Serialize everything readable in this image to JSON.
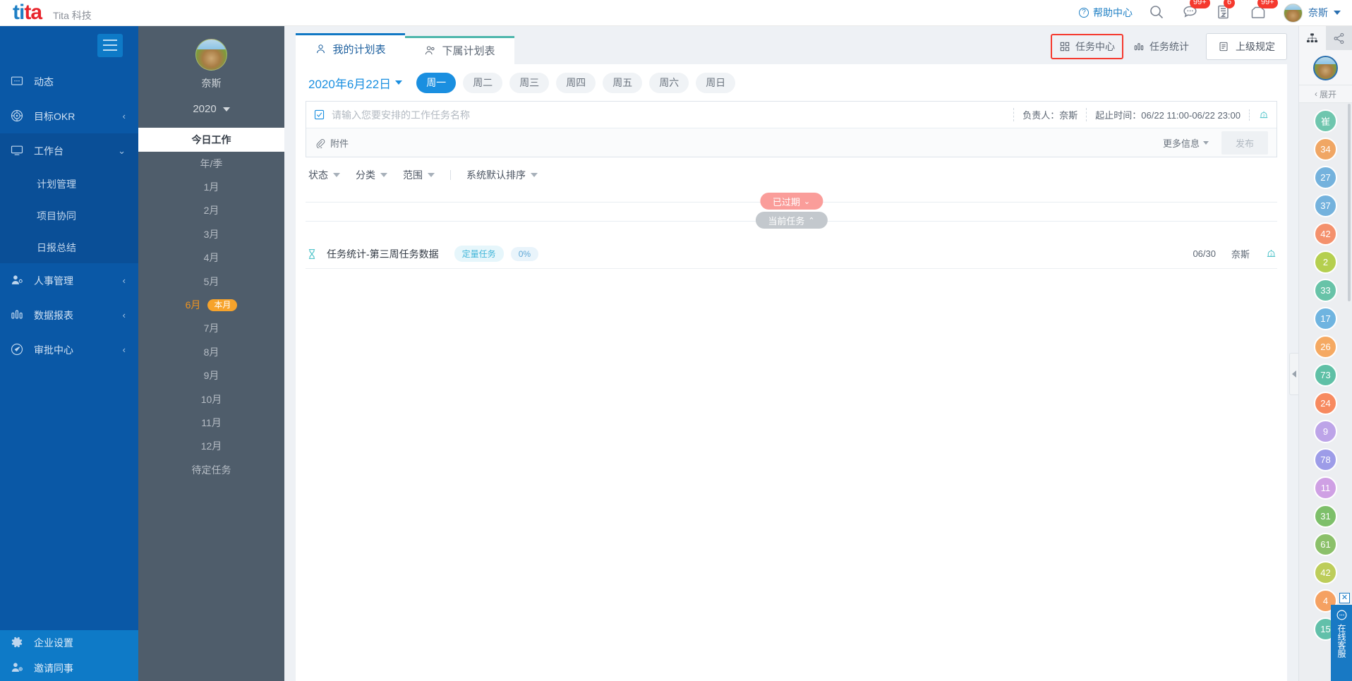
{
  "header": {
    "logo_text": "tita",
    "brand_sub": "Tita 科技",
    "help_center": "帮助中心",
    "icons": {
      "search": "search-icon",
      "message": "message-icon",
      "archive": "archive-icon",
      "mail": "mail-icon"
    },
    "badges": {
      "message": "99+",
      "archive": "6",
      "mail": "99+"
    },
    "user_name": "奈斯"
  },
  "sidebar": {
    "items": [
      {
        "label": "动态",
        "icon": "feed-icon",
        "chevron": "",
        "expanded": false
      },
      {
        "label": "目标OKR",
        "icon": "target-icon",
        "chevron": "‹",
        "expanded": false
      },
      {
        "label": "工作台",
        "icon": "desktop-icon",
        "chevron": "⌄",
        "expanded": true
      },
      {
        "label": "人事管理",
        "icon": "people-icon",
        "chevron": "‹",
        "expanded": false
      },
      {
        "label": "数据报表",
        "icon": "chart-icon",
        "chevron": "‹",
        "expanded": false
      },
      {
        "label": "审批中心",
        "icon": "approval-icon",
        "chevron": "‹",
        "expanded": false
      }
    ],
    "sub_items": [
      "计划管理",
      "项目协同",
      "日报总结"
    ],
    "bottom_items": [
      {
        "label": "企业设置",
        "icon": "gear-icon"
      },
      {
        "label": "邀请同事",
        "icon": "add-user-icon"
      }
    ]
  },
  "midbar": {
    "user_name": "奈斯",
    "year": "2020",
    "rows": [
      {
        "label": "今日工作",
        "state": "active"
      },
      {
        "label": "年/季",
        "state": "normal"
      },
      {
        "label": "1月",
        "state": "normal"
      },
      {
        "label": "2月",
        "state": "normal"
      },
      {
        "label": "3月",
        "state": "normal"
      },
      {
        "label": "4月",
        "state": "normal"
      },
      {
        "label": "5月",
        "state": "normal"
      },
      {
        "label": "6月",
        "state": "current",
        "pill": "本月"
      },
      {
        "label": "7月",
        "state": "normal"
      },
      {
        "label": "8月",
        "state": "normal"
      },
      {
        "label": "9月",
        "state": "normal"
      },
      {
        "label": "10月",
        "state": "normal"
      },
      {
        "label": "11月",
        "state": "normal"
      },
      {
        "label": "12月",
        "state": "normal"
      },
      {
        "label": "待定任务",
        "state": "normal"
      }
    ]
  },
  "main": {
    "tabs": [
      {
        "label": "我的计划表",
        "icon": "user-icon",
        "active": true
      },
      {
        "label": "下属计划表",
        "icon": "users-icon",
        "active": false
      }
    ],
    "actions": {
      "task_center": "任务中心",
      "task_stats": "任务统计",
      "superior_rules": "上级规定"
    },
    "date_selector": "2020年6月22日",
    "weekdays": [
      {
        "label": "周一",
        "selected": true
      },
      {
        "label": "周二",
        "selected": false
      },
      {
        "label": "周三",
        "selected": false
      },
      {
        "label": "周四",
        "selected": false
      },
      {
        "label": "周五",
        "selected": false
      },
      {
        "label": "周六",
        "selected": false
      },
      {
        "label": "周日",
        "selected": false
      }
    ],
    "input": {
      "placeholder": "请输入您要安排的工作任务名称",
      "value": "",
      "owner_label": "负责人：",
      "owner_value": "奈斯",
      "time_label": "起止时间：",
      "time_value": "06/22 11:00-06/22 23:00",
      "attach_label": "附件",
      "more_info_label": "更多信息",
      "publish_label": "发布"
    },
    "filters": [
      {
        "label": "状态"
      },
      {
        "label": "分类"
      },
      {
        "label": "范围"
      }
    ],
    "sort_label": "系统默认排序",
    "dividers": [
      {
        "label": "已过期",
        "arrow": "⌄",
        "kind": "expired"
      },
      {
        "label": "当前任务",
        "arrow": "⌃",
        "kind": "current"
      }
    ],
    "tasks": [
      {
        "title": "任务统计-第三周任务数据",
        "tag": "定量任务",
        "percent": "0%",
        "date": "06/30",
        "owner": "奈斯"
      }
    ]
  },
  "right_rail": {
    "expand_label": "展开",
    "tabs": [
      {
        "icon": "org-tree-icon",
        "active": true
      },
      {
        "icon": "share-icon",
        "active": false
      }
    ],
    "dots": [
      {
        "label": "崔",
        "color": "#6fc6ae"
      },
      {
        "label": "34",
        "color": "#f0a664"
      },
      {
        "label": "27",
        "color": "#74b2dd"
      },
      {
        "label": "37",
        "color": "#74b2dd"
      },
      {
        "label": "42",
        "color": "#f4916d"
      },
      {
        "label": "2",
        "color": "#b5cf4f"
      },
      {
        "label": "33",
        "color": "#68c3a8"
      },
      {
        "label": "17",
        "color": "#6fb4e0"
      },
      {
        "label": "26",
        "color": "#f5a962"
      },
      {
        "label": "73",
        "color": "#5fc0a6"
      },
      {
        "label": "24",
        "color": "#f78a60"
      },
      {
        "label": "9",
        "color": "#bda4e8"
      },
      {
        "label": "78",
        "color": "#9d9ce8"
      },
      {
        "label": "11",
        "color": "#cfa0e4"
      },
      {
        "label": "31",
        "color": "#7dbf6a"
      },
      {
        "label": "61",
        "color": "#8bc06a"
      },
      {
        "label": "42",
        "color": "#bdcd5a"
      },
      {
        "label": "4",
        "color": "#f5a162"
      },
      {
        "label": "15",
        "color": "#62c0aa"
      }
    ],
    "chat_label": "在线客服",
    "chat_close": "✕"
  }
}
